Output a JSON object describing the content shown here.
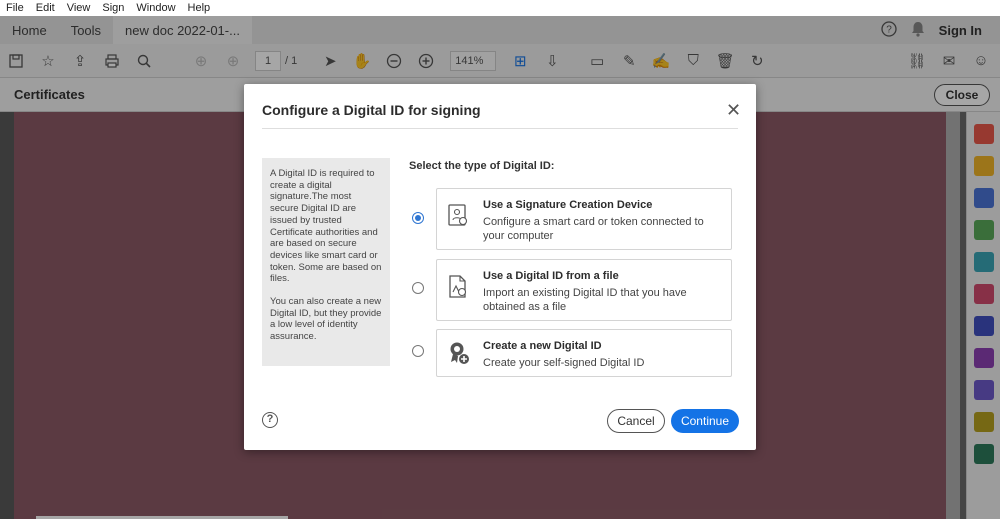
{
  "menu": [
    "File",
    "Edit",
    "View",
    "Sign",
    "Window",
    "Help"
  ],
  "topnav": {
    "home": "Home",
    "tools": "Tools",
    "doc_tab": "new doc 2022-01-...",
    "sign_in": "Sign In"
  },
  "toolbar": {
    "page_current": "1",
    "page_total": "/ 1",
    "zoom": "141%"
  },
  "certbar": {
    "title": "Certificates",
    "close": "Close"
  },
  "modal": {
    "title": "Configure a Digital ID for signing",
    "close_glyph": "✕",
    "info_p1": "A Digital ID is required to create a digital signature.The most secure Digital ID are issued by trusted Certificate authorities and are based on secure devices like smart card or token. Some are based on files.",
    "info_p2": "You can also create a new Digital ID, but they provide a low level of identity assurance.",
    "select_label": "Select the type of Digital ID:",
    "options": [
      {
        "title": "Use a Signature Creation Device",
        "desc": "Configure a smart card or token connected to your computer",
        "selected": true
      },
      {
        "title": "Use a Digital ID from a file",
        "desc": "Import an existing Digital ID that you have obtained as a file",
        "selected": false
      },
      {
        "title": "Create a new Digital ID",
        "desc": "Create your self-signed Digital ID",
        "selected": false
      }
    ],
    "help_glyph": "?",
    "cancel": "Cancel",
    "continue": "Continue"
  },
  "colors": {
    "accent": "#1473e6",
    "document": "#8c5a66"
  }
}
